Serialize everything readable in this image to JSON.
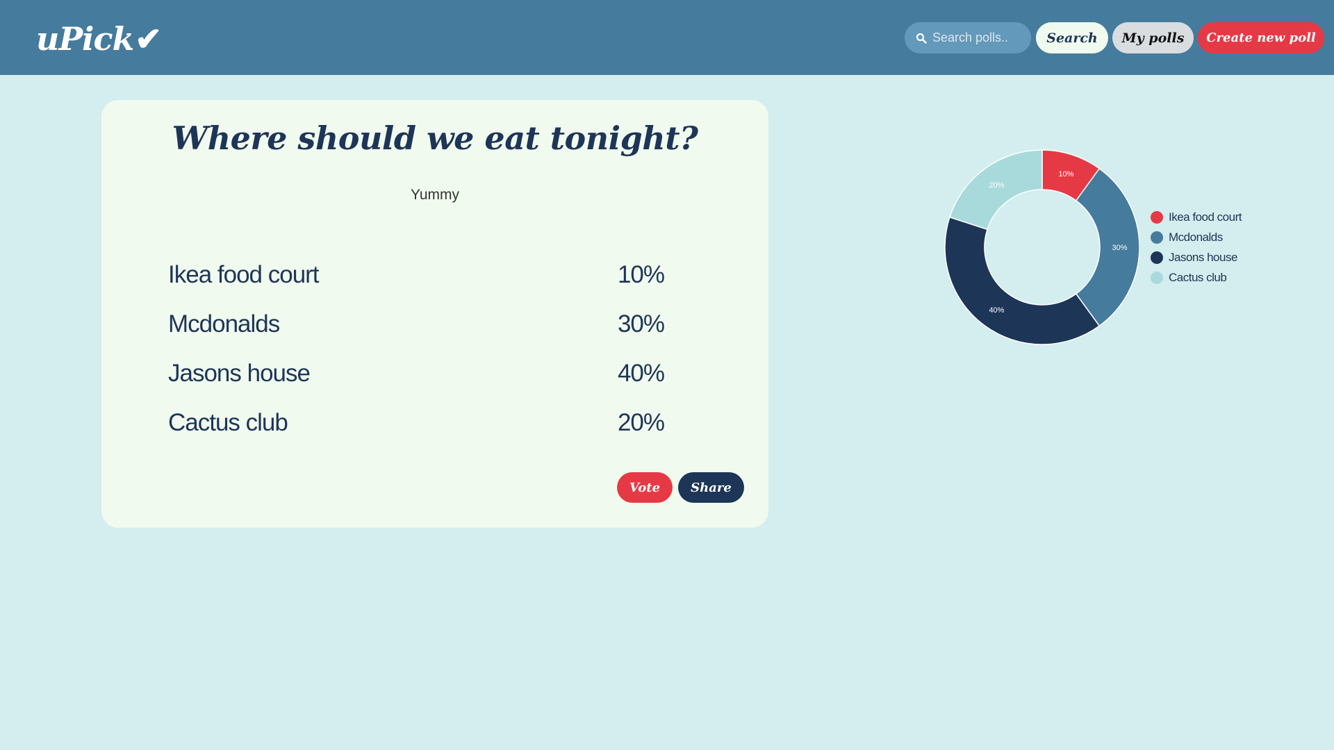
{
  "header": {
    "logo_text": "uPick",
    "logo_mark": "✔",
    "search_placeholder": "Search polls..",
    "search_label": "Search",
    "my_polls_label": "My polls",
    "create_label": "Create new poll"
  },
  "poll": {
    "title": "Where should we eat tonight?",
    "description": "Yummy",
    "options": [
      {
        "label": "Ikea food court",
        "percent": "10%"
      },
      {
        "label": "Mcdonalds",
        "percent": "30%"
      },
      {
        "label": "Jasons house",
        "percent": "40%"
      },
      {
        "label": "Cactus club",
        "percent": "20%"
      }
    ],
    "vote_label": "Vote",
    "share_label": "Share"
  },
  "colors": {
    "header_bg": "#457b9d",
    "page_bg": "#d4edee",
    "card_bg": "#f1faee",
    "red": "#e63946",
    "steel_blue": "#457b9d",
    "navy": "#1d3557",
    "light_teal": "#a8dadc"
  },
  "chart_data": {
    "type": "pie",
    "variant": "donut",
    "categories": [
      "Ikea food court",
      "Mcdonalds",
      "Jasons house",
      "Cactus club"
    ],
    "values": [
      10,
      30,
      40,
      20
    ],
    "labels": [
      "10%",
      "30%",
      "40%",
      "20%"
    ],
    "colors": [
      "#e63946",
      "#457b9d",
      "#1d3557",
      "#a8dadc"
    ],
    "legend": "right"
  }
}
